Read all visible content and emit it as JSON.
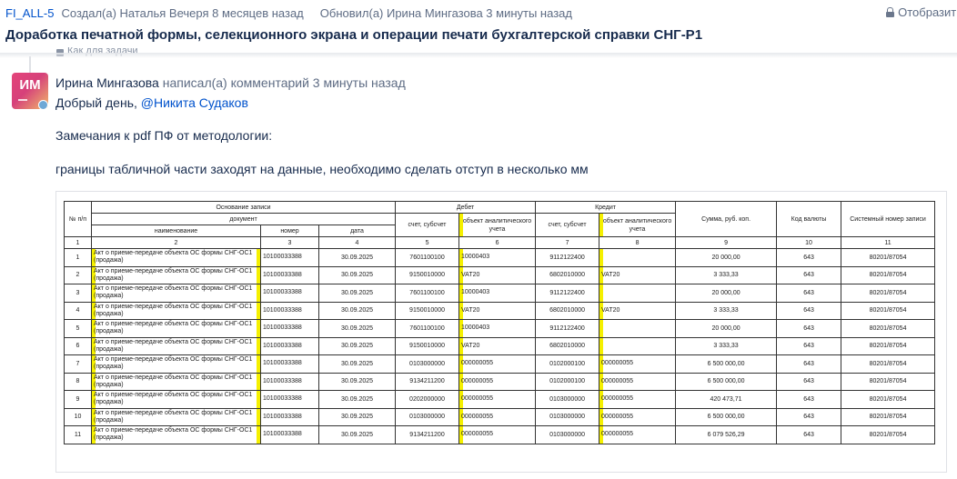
{
  "header": {
    "issue_key": "FI_ALL-5",
    "created": "Создал(а) Наталья Вечеря 8 месяцев назад",
    "updated": "Обновил(а) Ирина Мингазова 3 минуты назад",
    "display_label": "Отобразить"
  },
  "title": "Доработка печатной формы, селекционного экрана и операции печати бухгалтерской справки СНГ-Р1",
  "collapsed_hint": "Как для задачи",
  "comment": {
    "avatar_initials": "ИМ",
    "author": "Ирина Мингазова",
    "action": " написал(а) комментарий 3 минуты назад",
    "greeting": "Добрый день, ",
    "mention": "@Никита Судаков",
    "line2": "Замечания к pdf ПФ от методологии:",
    "line3": "границы табличной части заходят на данные, необходимо сделать отступ в несколько мм"
  },
  "table": {
    "h_no": "№ п/п",
    "h_basis": "Основание записи",
    "h_document": "документ",
    "h_name": "наименование",
    "h_number": "номер",
    "h_date": "дата",
    "h_debit": "Дебет",
    "h_credit": "Кредит",
    "h_account": "счет, субсчет",
    "h_object": "объект аналитического учета",
    "h_sum": "Сумма, руб. коп.",
    "h_currency": "Код валюты",
    "h_sysnum": "Системный номер записи",
    "col_numbers": [
      "1",
      "2",
      "3",
      "4",
      "5",
      "6",
      "7",
      "8",
      "9",
      "10",
      "11"
    ],
    "rows": [
      {
        "n": "1",
        "name": "Акт о приеме-передаче объекта ОС формы СНГ-ОС1 (продажа)",
        "num": "10100033388",
        "date": "30.09.2025",
        "d_acc": "7601100100",
        "d_obj": "10000403",
        "c_acc": "9112122400",
        "c_obj": "",
        "sum": "20 000,00",
        "cur": "643",
        "sys": "80201/87054"
      },
      {
        "n": "2",
        "name": "Акт о приеме-передаче объекта ОС формы СНГ-ОС1 (продажа)",
        "num": "10100033388",
        "date": "30.09.2025",
        "d_acc": "9150010000",
        "d_obj": "VAT20",
        "c_acc": "6802010000",
        "c_obj": "VAT20",
        "sum": "3 333,33",
        "cur": "643",
        "sys": "80201/87054"
      },
      {
        "n": "3",
        "name": "Акт о приеме-передаче объекта ОС формы СНГ-ОС1 (продажа)",
        "num": "10100033388",
        "date": "30.09.2025",
        "d_acc": "7601100100",
        "d_obj": "10000403",
        "c_acc": "9112122400",
        "c_obj": "",
        "sum": "20 000,00",
        "cur": "643",
        "sys": "80201/87054"
      },
      {
        "n": "4",
        "name": "Акт о приеме-передаче объекта ОС формы СНГ-ОС1 (продажа)",
        "num": "10100033388",
        "date": "30.09.2025",
        "d_acc": "9150010000",
        "d_obj": "VAT20",
        "c_acc": "6802010000",
        "c_obj": "VAT20",
        "sum": "3 333,33",
        "cur": "643",
        "sys": "80201/87054"
      },
      {
        "n": "5",
        "name": "Акт о приеме-передаче объекта ОС формы СНГ-ОС1 (продажа)",
        "num": "10100033388",
        "date": "30.09.2025",
        "d_acc": "7601100100",
        "d_obj": "10000403",
        "c_acc": "9112122400",
        "c_obj": "",
        "sum": "20 000,00",
        "cur": "643",
        "sys": "80201/87054"
      },
      {
        "n": "6",
        "name": "Акт о приеме-передаче объекта ОС формы СНГ-ОС1 (продажа)",
        "num": "10100033388",
        "date": "30.09.2025",
        "d_acc": "9150010000",
        "d_obj": "VAT20",
        "c_acc": "6802010000",
        "c_obj": "",
        "sum": "3 333,33",
        "cur": "643",
        "sys": "80201/87054"
      },
      {
        "n": "7",
        "name": "Акт о приеме-передаче объекта ОС формы СНГ-ОС1 (продажа)",
        "num": "10100033388",
        "date": "30.09.2025",
        "d_acc": "0103000000",
        "d_obj": "000000055",
        "c_acc": "0102000100",
        "c_obj": "000000055",
        "sum": "6 500 000,00",
        "cur": "643",
        "sys": "80201/87054"
      },
      {
        "n": "8",
        "name": "Акт о приеме-передаче объекта ОС формы СНГ-ОС1 (продажа)",
        "num": "10100033388",
        "date": "30.09.2025",
        "d_acc": "9134211200",
        "d_obj": "000000055",
        "c_acc": "0102000100",
        "c_obj": "000000055",
        "sum": "6 500 000,00",
        "cur": "643",
        "sys": "80201/87054"
      },
      {
        "n": "9",
        "name": "Акт о приеме-передаче объекта ОС формы СНГ-ОС1 (продажа)",
        "num": "10100033388",
        "date": "30.09.2025",
        "d_acc": "0202000000",
        "d_obj": "000000055",
        "c_acc": "0103000000",
        "c_obj": "000000055",
        "sum": "420 473,71",
        "cur": "643",
        "sys": "80201/87054"
      },
      {
        "n": "10",
        "name": "Акт о приеме-передаче объекта ОС формы СНГ-ОС1 (продажа)",
        "num": "10100033388",
        "date": "30.09.2025",
        "d_acc": "0103000000",
        "d_obj": "000000055",
        "c_acc": "0103000000",
        "c_obj": "000000055",
        "sum": "6 500 000,00",
        "cur": "643",
        "sys": "80201/87054"
      },
      {
        "n": "11",
        "name": "Акт о приеме-передаче объекта ОС формы СНГ-ОС1 (продажа)",
        "num": "10100033388",
        "date": "30.09.2025",
        "d_acc": "9134211200",
        "d_obj": "000000055",
        "c_acc": "0103000000",
        "c_obj": "000000055",
        "sum": "6 079 526,29",
        "cur": "643",
        "sys": "80201/87054"
      }
    ]
  },
  "colors": {
    "link": "#0052cc",
    "text": "#172b4d",
    "muted": "#5e6c84",
    "highlight": "#f5f000"
  }
}
